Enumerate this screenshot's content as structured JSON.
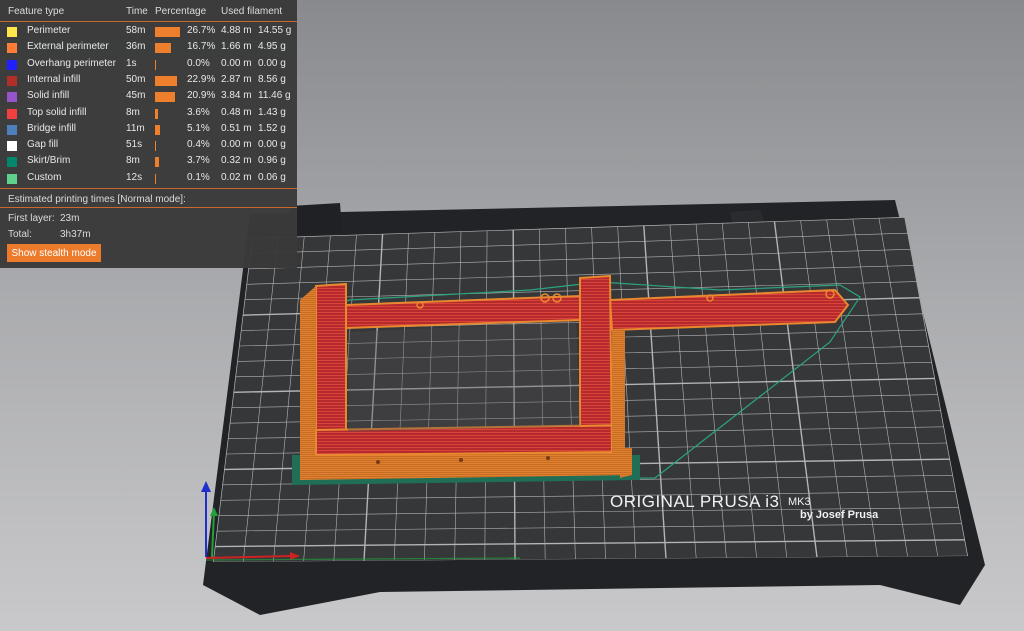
{
  "legend": {
    "headers": {
      "feature_type": "Feature type",
      "time": "Time",
      "percentage": "Percentage",
      "used_filament": "Used filament"
    },
    "rows": [
      {
        "name": "Perimeter",
        "color": "#ffe64d",
        "time": "58m",
        "percent": "26.7%",
        "length": "4.88 m",
        "weight": "14.55 g",
        "fraction": 0.267
      },
      {
        "name": "External perimeter",
        "color": "#ff7d38",
        "time": "36m",
        "percent": "16.7%",
        "length": "1.66 m",
        "weight": "4.95 g",
        "fraction": 0.167
      },
      {
        "name": "Overhang perimeter",
        "color": "#1f1fff",
        "time": "1s",
        "percent": "0.0%",
        "length": "0.00 m",
        "weight": "0.00 g",
        "fraction": 0.0
      },
      {
        "name": "Internal infill",
        "color": "#b03029",
        "time": "50m",
        "percent": "22.9%",
        "length": "2.87 m",
        "weight": "8.56 g",
        "fraction": 0.229
      },
      {
        "name": "Solid infill",
        "color": "#9654cc",
        "time": "45m",
        "percent": "20.9%",
        "length": "3.84 m",
        "weight": "11.46 g",
        "fraction": 0.209
      },
      {
        "name": "Top solid infill",
        "color": "#f04040",
        "time": "8m",
        "percent": "3.6%",
        "length": "0.48 m",
        "weight": "1.43 g",
        "fraction": 0.036
      },
      {
        "name": "Bridge infill",
        "color": "#4d80ba",
        "time": "11m",
        "percent": "5.1%",
        "length": "0.51 m",
        "weight": "1.52 g",
        "fraction": 0.051
      },
      {
        "name": "Gap fill",
        "color": "#ffffff",
        "time": "51s",
        "percent": "0.4%",
        "length": "0.00 m",
        "weight": "0.00 g",
        "fraction": 0.004
      },
      {
        "name": "Skirt/Brim",
        "color": "#00876e",
        "time": "8m",
        "percent": "3.7%",
        "length": "0.32 m",
        "weight": "0.96 g",
        "fraction": 0.037
      },
      {
        "name": "Custom",
        "color": "#5ed28c",
        "time": "12s",
        "percent": "0.1%",
        "length": "0.02 m",
        "weight": "0.06 g",
        "fraction": 0.001
      }
    ],
    "estimated_title": "Estimated printing times [Normal mode]:",
    "first_layer_label": "First layer:",
    "first_layer_value": "23m",
    "total_label": "Total:",
    "total_value": "3h37m",
    "stealth_button": "Show stealth mode"
  },
  "bed": {
    "logo_line1": "ORIGINAL PRUSA i3",
    "logo_mk": "MK3",
    "logo_line2": "by Josef Prusa"
  }
}
